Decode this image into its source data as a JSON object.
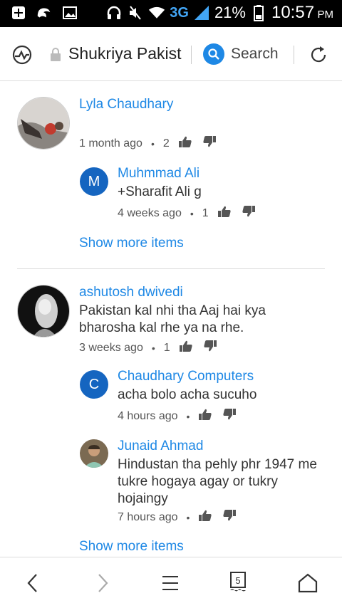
{
  "status_bar": {
    "left_icons": [
      "plus-box-icon",
      "uc-browser-icon",
      "image-icon"
    ],
    "network": "3G",
    "battery": "21%",
    "time": "10:57",
    "ampm": "PM"
  },
  "address_bar": {
    "title": "Shukriya Pakist",
    "search_label": "Search"
  },
  "comments": [
    {
      "author": "Lyla Chaudhary",
      "text": "",
      "time": "1 month ago",
      "likes": "2",
      "replies": [
        {
          "initial": "M",
          "author": "Muhmmad Ali",
          "text": "+Sharafit Ali g",
          "time": "4 weeks ago",
          "likes": "1"
        }
      ],
      "show_more": "Show more items"
    },
    {
      "author": "ashutosh dwivedi",
      "text": "Pakistan kal nhi tha Aaj hai kya bharosha kal rhe ya na rhe.",
      "time": "3 weeks ago",
      "likes": "1",
      "replies": [
        {
          "initial": "C",
          "author": "Chaudhary Computers",
          "text": "acha bolo acha sucuho",
          "time": "4 hours ago",
          "likes": ""
        },
        {
          "initial": "",
          "author": "Junaid Ahmad",
          "text": "Hindustan tha pehly phr 1947 me tukre hogaya agay or tukry hojaingy",
          "time": "7 hours ago",
          "likes": ""
        }
      ],
      "show_more": "Show more items"
    }
  ],
  "bottom_nav": {
    "tab_count": "5"
  },
  "colors": {
    "link": "#1e88e5",
    "text": "#333333",
    "status_bar": "#000000",
    "accent_network": "#42a5f5"
  }
}
